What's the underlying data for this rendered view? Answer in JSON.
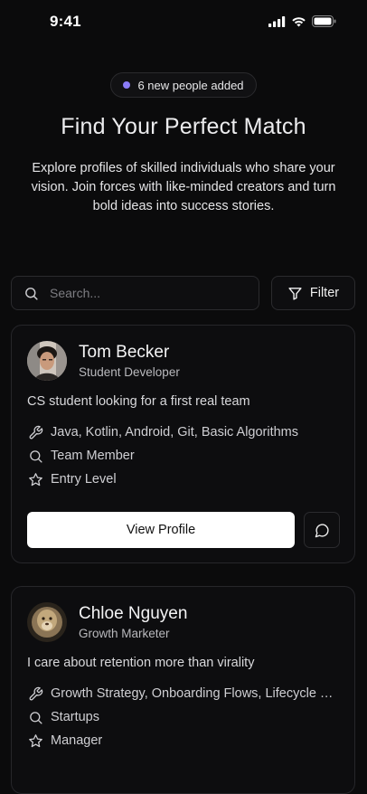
{
  "status_bar": {
    "time": "9:41"
  },
  "badge": {
    "text": "6 new people added",
    "dot_color": "#8b7cf6"
  },
  "hero": {
    "title": "Find Your Perfect Match",
    "subtitle": "Explore profiles of skilled individuals who share your vision. Join forces with like-minded creators and turn bold ideas into success stories."
  },
  "search": {
    "placeholder": "Search..."
  },
  "filter": {
    "label": "Filter"
  },
  "profiles": [
    {
      "name": "Tom Becker",
      "role": "Student Developer",
      "bio": "CS student looking for a first real team",
      "skills": "Java, Kotlin, Android, Git, Basic Algorithms",
      "looking_for": "Team Member",
      "level": "Entry Level",
      "view_label": "View Profile"
    },
    {
      "name": "Chloe Nguyen",
      "role": "Growth Marketer",
      "bio": "I care about retention more than virality",
      "skills": "Growth Strategy, Onboarding Flows, Lifecycle Marketing",
      "looking_for": "Startups",
      "level": "Manager"
    }
  ]
}
